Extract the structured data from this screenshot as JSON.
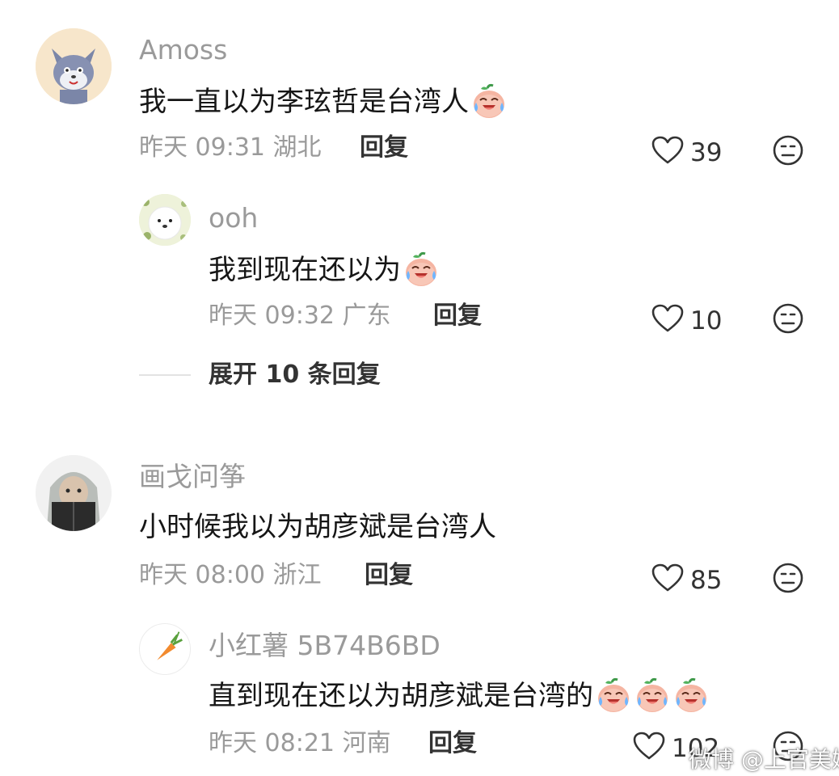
{
  "comments": [
    {
      "username": "Amoss",
      "text": "我一直以为李玹哲是台湾人",
      "emoji_count": 1,
      "time": "昨天 09:31",
      "location": "湖北",
      "reply_label": "回复",
      "likes": "39",
      "avatar_icon": "tom-cat-avatar",
      "replies": [
        {
          "username": "ooh",
          "text": "我到现在还以为",
          "emoji_count": 1,
          "time": "昨天 09:32",
          "location": "广东",
          "reply_label": "回复",
          "likes": "10",
          "avatar_icon": "white-dog-avatar"
        }
      ],
      "expand_label": "展开 10 条回复"
    },
    {
      "username": "画戈问筝",
      "text": "小时候我以为胡彦斌是台湾人",
      "emoji_count": 0,
      "time": "昨天 08:00",
      "location": "浙江",
      "reply_label": "回复",
      "likes": "85",
      "avatar_icon": "reading-girl-avatar",
      "replies": [
        {
          "username": "小红薯 5B74B6BD",
          "text": "直到现在还以为胡彦斌是台湾的",
          "emoji_count": 3,
          "time": "昨天 08:21",
          "location": "河南",
          "reply_label": "回复",
          "likes": "102",
          "avatar_icon": "carrot-avatar"
        }
      ]
    }
  ],
  "icons": {
    "like": "heart-outline-icon",
    "dislike": "neutral-face-icon",
    "emoji": "crying-laughing-peach-emoji"
  },
  "watermark": "微博 @上官美姨"
}
